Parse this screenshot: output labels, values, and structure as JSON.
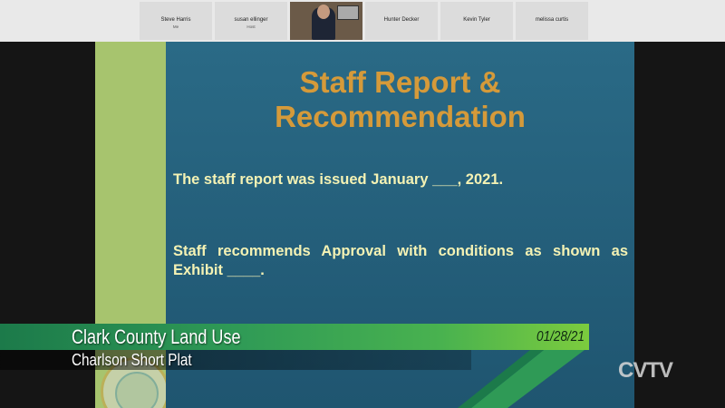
{
  "participants": [
    {
      "name": "Steve Harris",
      "role": "Me"
    },
    {
      "name": "susan ellinger",
      "role": "Host"
    },
    {
      "name": "",
      "role": ""
    },
    {
      "name": "Hunter Decker",
      "role": ""
    },
    {
      "name": "Kevin Tyler",
      "role": ""
    },
    {
      "name": "melissa curtis",
      "role": ""
    }
  ],
  "slide": {
    "title_line1": "Staff Report &",
    "title_line2": "Recommendation",
    "line1": "The staff report was issued January ___, 2021.",
    "line2": "Staff recommends Approval with conditions as shown as Exhibit ____."
  },
  "lower_third": {
    "title": "Clark County Land Use",
    "subtitle": "Charlson Short Plat",
    "date": "01/28/21"
  },
  "channel_bug": "CVTV",
  "colors": {
    "slide_bg": "#27637f",
    "slide_band": "#a7c46e",
    "title_text": "#d59a3a",
    "body_text": "#f4f2b4",
    "lower_third_green": "#2f9a56",
    "lower_third_lime": "#7ccc3e"
  }
}
